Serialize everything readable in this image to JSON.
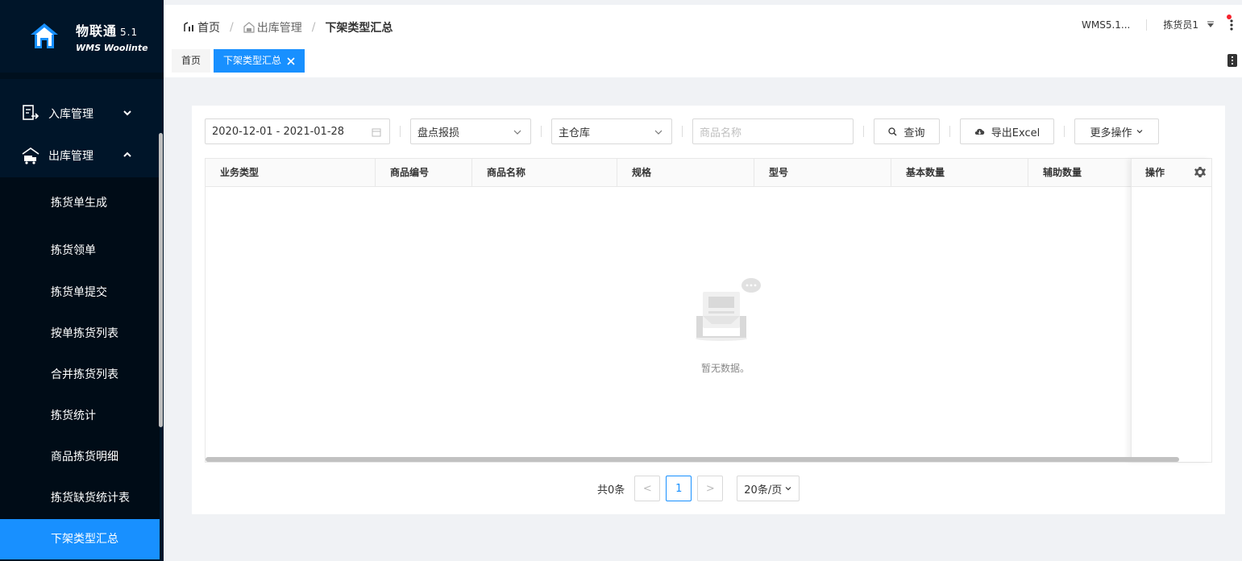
{
  "app": {
    "name": "物联通",
    "version": "5.1",
    "subtitle": "WMS Woolinte"
  },
  "sidebar": {
    "groups": [
      {
        "label": "入库管理",
        "icon": "inbound-icon",
        "expanded": false
      },
      {
        "label": "出库管理",
        "icon": "outbound-truck-icon",
        "expanded": true
      }
    ],
    "items": [
      {
        "label": "拣货单生成"
      },
      {
        "label": "拣货领单"
      },
      {
        "label": "拣货单提交"
      },
      {
        "label": "按单拣货列表"
      },
      {
        "label": "合并拣货列表"
      },
      {
        "label": "拣货统计"
      },
      {
        "label": "商品拣货明细"
      },
      {
        "label": "拣货缺货统计表"
      },
      {
        "label": "下架类型汇总",
        "active": true
      }
    ]
  },
  "header": {
    "breadcrumb": [
      "首页",
      "出库管理",
      "下架类型汇总"
    ],
    "separator": "/",
    "tabs": [
      {
        "label": "首页"
      },
      {
        "label": "下架类型汇总",
        "active": true
      }
    ],
    "version": "WMS5.1...",
    "user": "拣货员1"
  },
  "filters": {
    "date_range": "2020-12-01 - 2021-01-28",
    "type": "盘点报损",
    "warehouse": "主仓库",
    "product_placeholder": "商品名称",
    "query_label": "查询",
    "export_label": "导出Excel",
    "more_label": "更多操作"
  },
  "table": {
    "columns": [
      "业务类型",
      "商品编号",
      "商品名称",
      "规格",
      "型号",
      "基本数量",
      "辅助数量"
    ],
    "action_column": "操作",
    "rows": [],
    "empty_text": "暂无数据。"
  },
  "pagination": {
    "total_label": "共0条",
    "current_page": "1",
    "page_size": "20条/页",
    "prev": "<",
    "next": ">"
  },
  "colors": {
    "sidebar_bg": "#001529",
    "accent": "#1890ff",
    "notify": "#f5222d"
  }
}
